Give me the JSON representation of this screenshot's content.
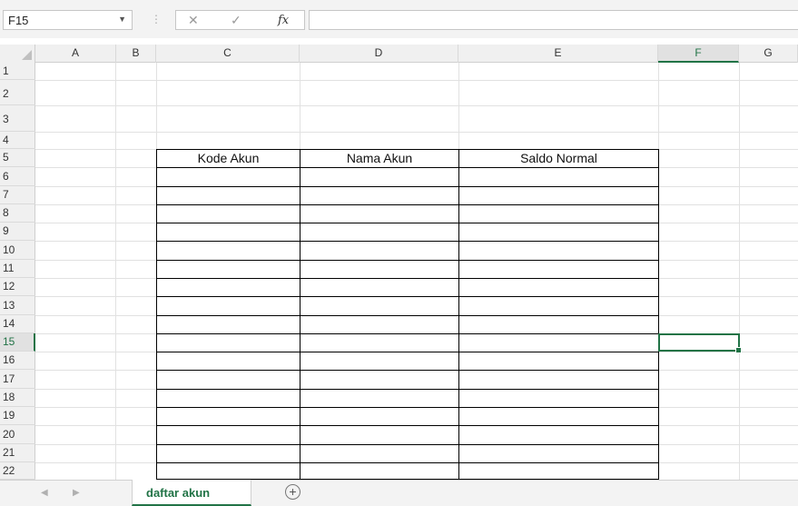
{
  "formula_bar": {
    "name_box": "F15",
    "name_box_arrow": "▼",
    "separator": "⋮",
    "cancel_symbol": "✕",
    "enter_symbol": "✓",
    "fx_label": "fx",
    "formula_value": ""
  },
  "columns": [
    "A",
    "B",
    "C",
    "D",
    "E",
    "F",
    "G"
  ],
  "rows": [
    "1",
    "2",
    "3",
    "4",
    "5",
    "6",
    "7",
    "8",
    "9",
    "10",
    "11",
    "12",
    "13",
    "14",
    "15",
    "16",
    "17",
    "18",
    "19",
    "20",
    "21",
    "22"
  ],
  "active_cell": "F15",
  "table": {
    "headers": [
      "Kode Akun",
      "Nama Akun",
      "Saldo Normal"
    ]
  },
  "sheet_tabs": {
    "prev_arrow": "◀",
    "next_arrow": "▶",
    "tabs": [
      {
        "label": "daftar akun",
        "active": true
      }
    ],
    "add_symbol": "+"
  },
  "colors": {
    "accent": "#217346",
    "header_bg": "#f0f0f0",
    "gridline": "#e1e1e1"
  }
}
